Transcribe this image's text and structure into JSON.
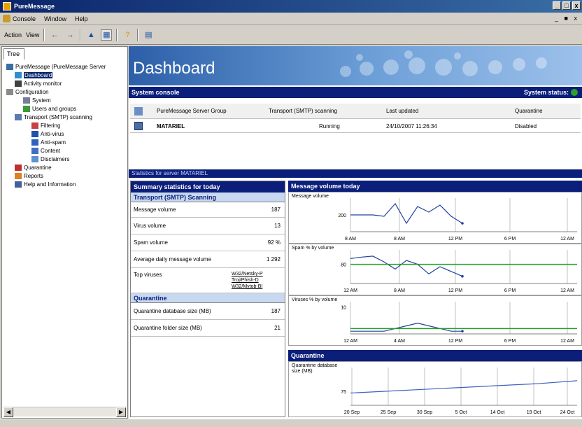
{
  "window": {
    "title": "PureMessage"
  },
  "menu": {
    "items": [
      "Console",
      "Window",
      "Help"
    ],
    "window_controls": "_ ■ x"
  },
  "toolbar": {
    "items": [
      "Action",
      "View"
    ]
  },
  "tree": {
    "tab": "Tree",
    "items": [
      {
        "label": "PureMessage (PureMessage Server",
        "indent": 0,
        "icon": "server-icon"
      },
      {
        "label": "Dashboard",
        "indent": 1,
        "icon": "dashboard-icon",
        "selected": true
      },
      {
        "label": "Activity monitor",
        "indent": 1,
        "icon": "monitor-icon"
      },
      {
        "label": "Configuration",
        "indent": 0,
        "icon": "folder-icon"
      },
      {
        "label": "System",
        "indent": 2,
        "icon": "gear-icon"
      },
      {
        "label": "Users and groups",
        "indent": 2,
        "icon": "users-icon"
      },
      {
        "label": "Transport (SMTP) scanning",
        "indent": 1,
        "icon": "transport-icon"
      },
      {
        "label": "Filtering",
        "indent": 3,
        "icon": "filter-icon"
      },
      {
        "label": "Anti-virus",
        "indent": 3,
        "icon": "shield-icon"
      },
      {
        "label": "Anti-spam",
        "indent": 3,
        "icon": "spam-icon"
      },
      {
        "label": "Content",
        "indent": 3,
        "icon": "content-icon"
      },
      {
        "label": "Disclaimers",
        "indent": 3,
        "icon": "disclaimer-icon"
      },
      {
        "label": "Quarantine",
        "indent": 1,
        "icon": "quarantine-icon"
      },
      {
        "label": "Reports",
        "indent": 1,
        "icon": "reports-icon"
      },
      {
        "label": "Help and Information",
        "indent": 1,
        "icon": "help-icon"
      }
    ]
  },
  "dashboard": {
    "title": "Dashboard",
    "system_console": {
      "header": "System console",
      "status_label": "System status:",
      "columns": [
        "PureMessage Server Group",
        "Transport (SMTP) scanning",
        "Last updated",
        "Quarantine"
      ],
      "row": {
        "name": "MATARIEL",
        "transport": "Running",
        "updated": "24/10/2007 11:26:34",
        "quarantine": "Disabled"
      }
    },
    "stats_bar": "Statistics for server MATARIEL",
    "summary": {
      "header": "Summary statistics for today",
      "transport_header": "Transport (SMTP) Scanning",
      "rows": [
        {
          "label": "Message volume",
          "value": "187"
        },
        {
          "label": "Virus volume",
          "value": "13"
        },
        {
          "label": "Spam volume",
          "value": "92 %"
        },
        {
          "label": "Average daily message volume",
          "value": "1 292"
        }
      ],
      "top_viruses_label": "Top viruses",
      "top_viruses": [
        "W32/Netsky-P",
        "Troj/Phish-D",
        "W32/Mytob-BI"
      ],
      "quarantine_header": "Quarantine",
      "quarantine_rows": [
        {
          "label": "Quarantine database size (MB)",
          "value": "187"
        },
        {
          "label": "Quarantine folder size (MB)",
          "value": "21"
        }
      ]
    },
    "message_volume": {
      "header": "Message volume today",
      "charts": [
        {
          "label": "Message volume",
          "ytick": "200",
          "xticks": [
            "8 AM",
            "8 AM",
            "12 PM",
            "6 PM",
            "12 AM"
          ]
        },
        {
          "label": "Spam % by volume",
          "ytick": "80",
          "xticks": [
            "12 AM",
            "8 AM",
            "12 PM",
            "6 PM",
            "12 AM"
          ]
        },
        {
          "label": "Viruses % by volume",
          "ytick": "10",
          "xticks": [
            "12 AM",
            "4 AM",
            "12 PM",
            "6 PM",
            "12 AM"
          ]
        }
      ]
    },
    "quarantine_chart": {
      "header": "Quarantine",
      "label": "Quarantine database size (MB)",
      "ytick": "75",
      "xticks": [
        "20 Sep",
        "25 Sep",
        "30 Sep",
        "5 Oct",
        "14 Oct",
        "19 Oct",
        "24 Oct"
      ]
    }
  },
  "chart_data": [
    {
      "type": "line",
      "title": "Message volume",
      "x": [
        0,
        1,
        2,
        3,
        4,
        5,
        6,
        7,
        8,
        9,
        10
      ],
      "series": [
        {
          "values": [
            200,
            200,
            200,
            195,
            240,
            170,
            230,
            210,
            235,
            195,
            170
          ]
        }
      ]
    },
    {
      "type": "line",
      "title": "Spam % by volume",
      "x": [
        0,
        1,
        2,
        3,
        4,
        5,
        6,
        7,
        8,
        9,
        10
      ],
      "series": [
        {
          "values": [
            92,
            95,
            97,
            85,
            70,
            88,
            80,
            60,
            75,
            65,
            55
          ]
        },
        {
          "values": [
            80,
            80,
            80,
            80,
            80,
            80,
            80,
            80,
            80,
            80,
            80
          ]
        }
      ]
    },
    {
      "type": "line",
      "title": "Viruses % by volume",
      "x": [
        0,
        1,
        2,
        3,
        4,
        5,
        6,
        7,
        8,
        9,
        10
      ],
      "series": [
        {
          "values": [
            1,
            1,
            1,
            1,
            2,
            3,
            4,
            3,
            2,
            1,
            1
          ]
        },
        {
          "values": [
            2,
            2,
            2,
            2,
            2,
            2,
            2,
            2,
            2,
            2,
            2
          ]
        }
      ]
    },
    {
      "type": "line",
      "title": "Quarantine database size (MB)",
      "x": [
        0,
        1,
        2,
        3,
        4,
        5,
        6
      ],
      "series": [
        {
          "values": [
            73,
            75,
            77,
            79,
            81,
            83,
            86
          ]
        }
      ]
    }
  ]
}
